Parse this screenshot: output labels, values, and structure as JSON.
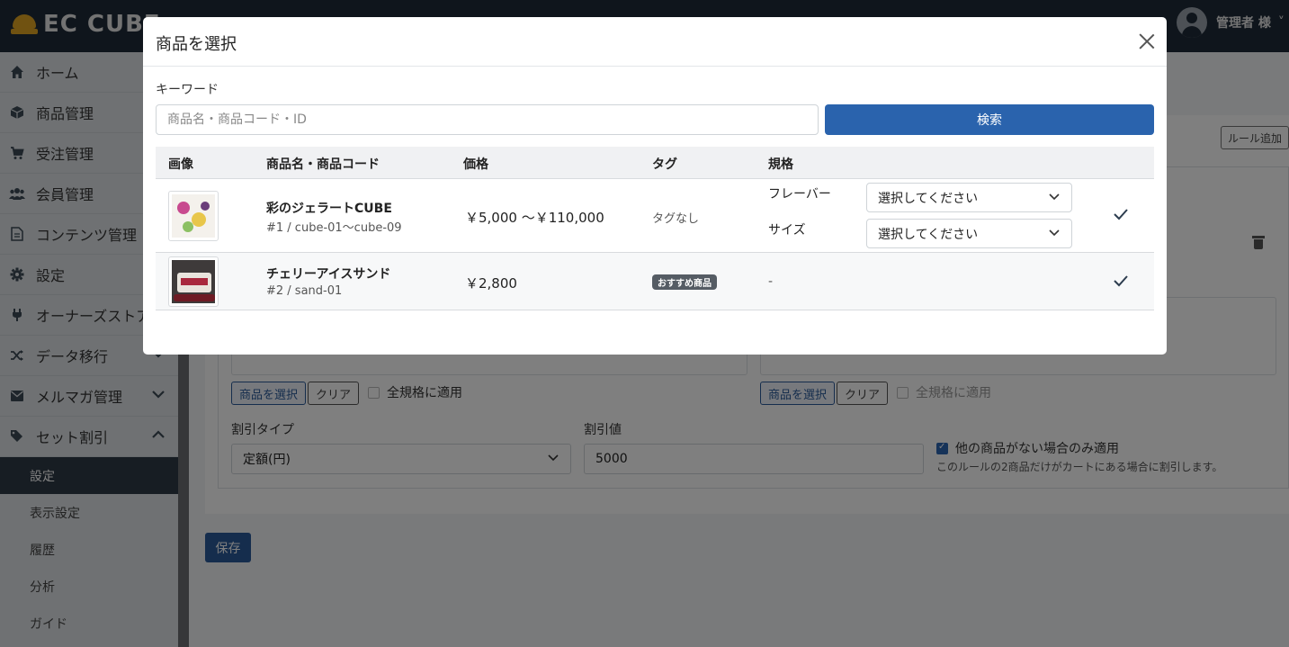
{
  "header": {
    "logo_text": "EC CUBE",
    "user_name": "管理者 様",
    "user_chevron": "˅"
  },
  "sidebar": {
    "items": [
      {
        "label": "ホーム",
        "icon": "home-icon"
      },
      {
        "label": "商品管理",
        "icon": "cube-icon"
      },
      {
        "label": "受注管理",
        "icon": "cart-icon"
      },
      {
        "label": "会員管理",
        "icon": "users-icon"
      },
      {
        "label": "コンテンツ管理",
        "icon": "file-icon"
      },
      {
        "label": "設定",
        "icon": "gear-icon"
      },
      {
        "label": "オーナーズストア",
        "icon": "plug-icon"
      },
      {
        "label": "データ移行",
        "icon": "shuffle-icon"
      },
      {
        "label": "メルマガ管理",
        "icon": "mail-icon"
      },
      {
        "label": "セット割引",
        "icon": "tags-icon"
      }
    ],
    "sub_items": [
      "設定",
      "表示設定",
      "履歴",
      "分析",
      "ガイド"
    ]
  },
  "background": {
    "rule_add": "ルール追加",
    "select_product_1": "商品を選択",
    "clear_1": "クリア",
    "apply_all_1": "全規格に適用",
    "select_product_2": "商品を選択",
    "clear_2": "クリア",
    "apply_all_2": "全規格に適用",
    "discount_type_label": "割引タイプ",
    "discount_type_value": "定額(円)",
    "discount_value_label": "割引値",
    "discount_value": "5000",
    "only_if_label": "他の商品がない場合のみ適用",
    "only_if_note": "このルールの2商品だけがカートにある場合に割引します。",
    "save": "保存"
  },
  "modal": {
    "title": "商品を選択",
    "keyword_label": "キーワード",
    "keyword_placeholder": "商品名・商品コード・ID",
    "search_button": "検索",
    "columns": {
      "image": "画像",
      "name": "商品名・商品コード",
      "price": "価格",
      "tag": "タグ",
      "spec": "規格"
    },
    "rows": [
      {
        "name": "彩のジェラートCUBE",
        "code": "#1 / cube-01〜cube-09",
        "price": "￥5,000 〜￥110,000",
        "tag": "タグなし",
        "spec1_label": "フレーバー",
        "spec1_value": "選択してください",
        "spec2_label": "サイズ",
        "spec2_value": "選択してください"
      },
      {
        "name": "チェリーアイスサンド",
        "code": "#2 / sand-01",
        "price": "￥2,800",
        "tag": "おすすめ商品",
        "spec": "-"
      }
    ]
  }
}
